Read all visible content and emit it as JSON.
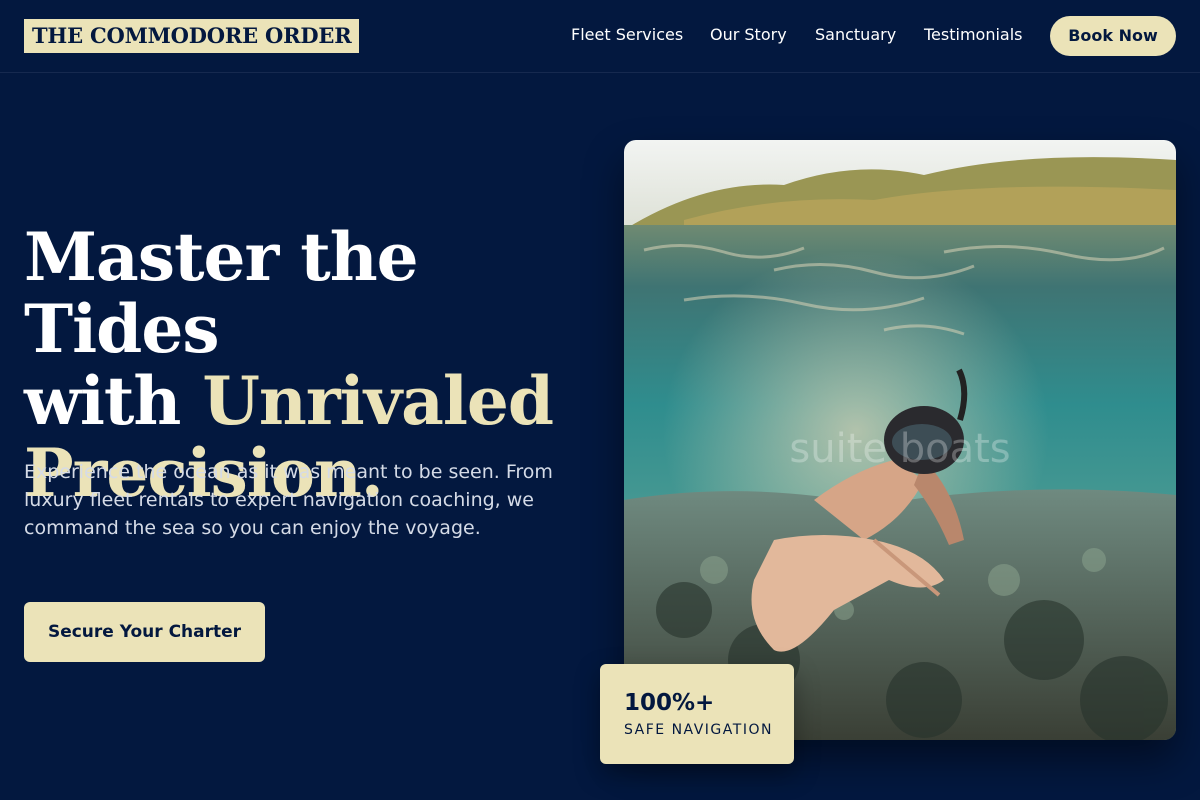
{
  "header": {
    "logo_text": "THE COMMODORE ORDER",
    "nav": [
      {
        "label": "Fleet Services"
      },
      {
        "label": "Our Story"
      },
      {
        "label": "Sanctuary"
      },
      {
        "label": "Testimonials"
      }
    ],
    "book_label": "Book Now"
  },
  "hero": {
    "title_line1": "Master the Tides",
    "title_line2_plain": "with ",
    "title_line2_accent": "Unrivaled",
    "title_line3_accent": "Precision.",
    "description": "Experience the ocean as it was meant to be seen. From luxury fleet rentals to expert navigation coaching, we command the sea so you can enjoy the voyage.",
    "cta_label": "Secure Your Charter",
    "image_watermark": "suite boats"
  },
  "stat": {
    "value": "100%+",
    "label": "SAFE NAVIGATION"
  },
  "colors": {
    "background": "#03183f",
    "accent": "#ebe3b8",
    "text": "#ffffff"
  }
}
